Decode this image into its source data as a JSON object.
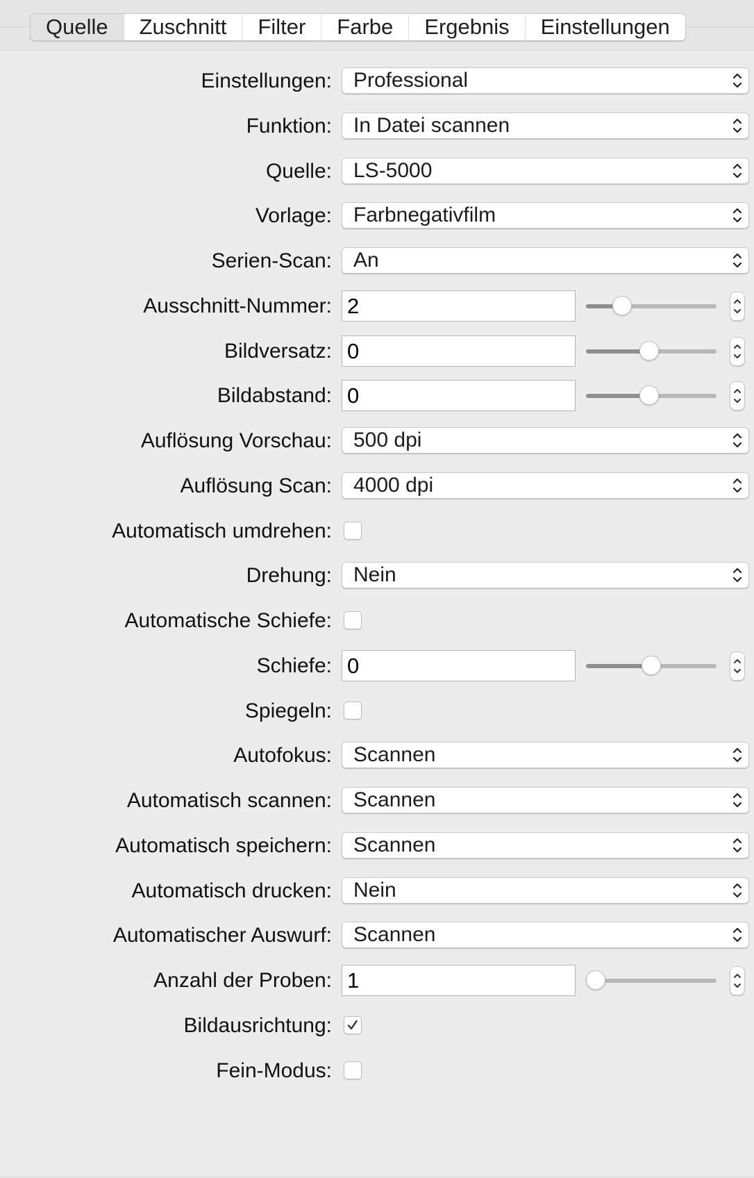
{
  "tabs": [
    {
      "label": "Quelle",
      "active": true
    },
    {
      "label": "Zuschnitt",
      "active": false
    },
    {
      "label": "Filter",
      "active": false
    },
    {
      "label": "Farbe",
      "active": false
    },
    {
      "label": "Ergebnis",
      "active": false
    },
    {
      "label": "Einstellungen",
      "active": false
    }
  ],
  "rows": [
    {
      "id": "einstellungen",
      "label": "Einstellungen:",
      "type": "popup",
      "value": "Professional"
    },
    {
      "id": "funktion",
      "label": "Funktion:",
      "type": "popup",
      "value": "In Datei scannen"
    },
    {
      "id": "quelle",
      "label": "Quelle:",
      "type": "popup",
      "value": "LS-5000"
    },
    {
      "id": "vorlage",
      "label": "Vorlage:",
      "type": "popup",
      "value": "Farbnegativfilm"
    },
    {
      "id": "serien-scan",
      "label": "Serien-Scan:",
      "type": "popup",
      "value": "An"
    },
    {
      "id": "ausschnitt-nummer",
      "label": "Ausschnitt-Nummer:",
      "type": "numeric",
      "value": "2",
      "slider_fraction": 0.24
    },
    {
      "id": "bildversatz",
      "label": "Bildversatz:",
      "type": "numeric",
      "value": "0",
      "slider_fraction": 0.48
    },
    {
      "id": "bildabstand",
      "label": "Bildabstand:",
      "type": "numeric",
      "value": "0",
      "slider_fraction": 0.48
    },
    {
      "id": "aufloesung-vorschau",
      "label": "Auflösung Vorschau:",
      "type": "popup",
      "value": "500 dpi"
    },
    {
      "id": "aufloesung-scan",
      "label": "Auflösung Scan:",
      "type": "popup",
      "value": "4000 dpi"
    },
    {
      "id": "automatisch-umdrehen",
      "label": "Automatisch umdrehen:",
      "type": "checkbox",
      "checked": false
    },
    {
      "id": "drehung",
      "label": "Drehung:",
      "type": "popup",
      "value": "Nein"
    },
    {
      "id": "automatische-schiefe",
      "label": "Automatische Schiefe:",
      "type": "checkbox",
      "checked": false
    },
    {
      "id": "schiefe",
      "label": "Schiefe:",
      "type": "numeric",
      "value": "0",
      "slider_fraction": 0.5
    },
    {
      "id": "spiegeln",
      "label": "Spiegeln:",
      "type": "checkbox",
      "checked": false
    },
    {
      "id": "autofokus",
      "label": "Autofokus:",
      "type": "popup",
      "value": "Scannen"
    },
    {
      "id": "automatisch-scannen",
      "label": "Automatisch scannen:",
      "type": "popup",
      "value": "Scannen"
    },
    {
      "id": "automatisch-speichern",
      "label": "Automatisch speichern:",
      "type": "popup",
      "value": "Scannen"
    },
    {
      "id": "automatisch-drucken",
      "label": "Automatisch drucken:",
      "type": "popup",
      "value": "Nein"
    },
    {
      "id": "automatischer-auswurf",
      "label": "Automatischer Auswurf:",
      "type": "popup",
      "value": "Scannen"
    },
    {
      "id": "anzahl-der-proben",
      "label": "Anzahl der Proben:",
      "type": "numeric",
      "value": "1",
      "slider_fraction": 0.0
    },
    {
      "id": "bildausrichtung",
      "label": "Bildausrichtung:",
      "type": "checkbox",
      "checked": true
    },
    {
      "id": "fein-modus",
      "label": "Fein-Modus:",
      "type": "checkbox",
      "checked": false
    }
  ]
}
